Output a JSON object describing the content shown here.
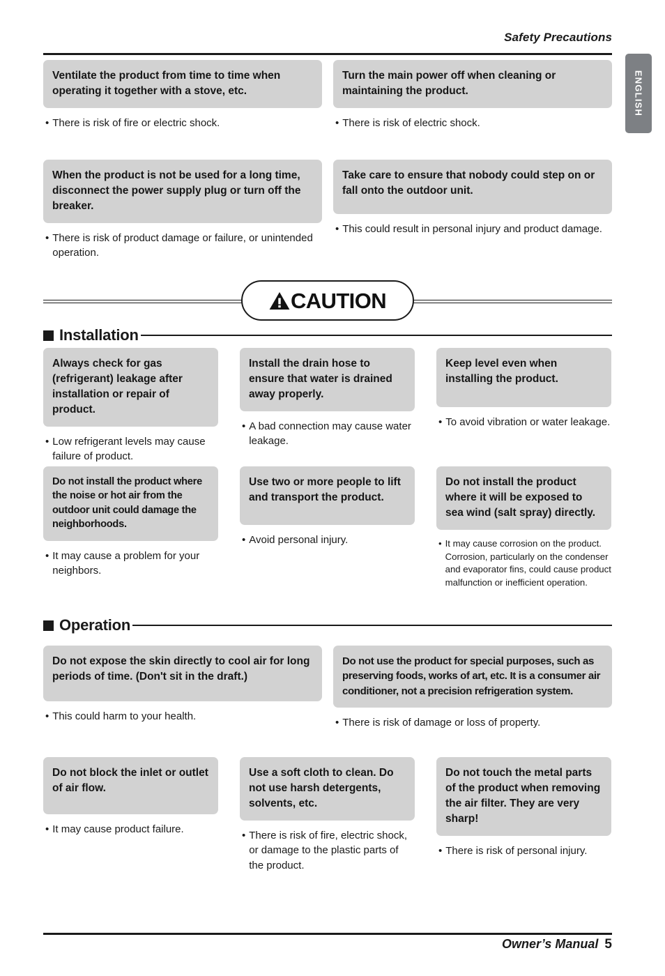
{
  "header": {
    "title": "Safety Precautions",
    "language_tab": "ENGLISH"
  },
  "caution": {
    "label": "CAUTION",
    "icon": "warning-triangle-icon"
  },
  "sections": [
    {
      "id": "warning-continued",
      "rows": [
        {
          "columns": 2,
          "cells": [
            {
              "heading": "Ventilate the product from time to time when operating it together with a stove, etc.",
              "note": "There is risk of fire or electric shock."
            },
            {
              "heading": "Turn the main power off when cleaning or maintaining the product.",
              "note": "There is risk of electric shock."
            }
          ]
        },
        {
          "columns": 2,
          "cells": [
            {
              "heading": "When the product is not be used for a long time, disconnect the power supply plug or turn off the breaker.",
              "note": "There is risk of product damage or failure, or unintended operation."
            },
            {
              "heading": "Take care to ensure that nobody could step on or fall onto the outdoor unit.",
              "note": "This could result in personal injury and product damage."
            }
          ]
        }
      ]
    },
    {
      "id": "installation",
      "title": "Installation",
      "marker": "black-square-icon",
      "rows": [
        {
          "columns": 3,
          "cells": [
            {
              "heading": "Always check for gas (refrigerant) leakage after installation or repair of product.",
              "note": "Low refrigerant levels may cause failure of product."
            },
            {
              "heading": "Install the drain hose to ensure that water is drained away properly.",
              "note": "A bad connection may cause water leakage."
            },
            {
              "heading": "Keep level even when installing the product.",
              "note": "To avoid vibration or water leakage."
            }
          ]
        },
        {
          "columns": 3,
          "cells": [
            {
              "heading": "Do not install the product where the noise or hot air from the outdoor unit could damage the neighborhoods.",
              "note": "It may cause a problem for your neighbors."
            },
            {
              "heading": "Use two or more people to lift and transport the product.",
              "note": "Avoid personal injury."
            },
            {
              "heading": "Do not install the product where it will be exposed to sea wind (salt spray) directly.",
              "note": "It may cause corrosion on the product. Corrosion, particularly on the condenser and evaporator fins, could cause product malfunction or inefficient operation."
            }
          ]
        }
      ]
    },
    {
      "id": "operation",
      "title": "Operation",
      "marker": "black-square-icon",
      "rows": [
        {
          "columns": 2,
          "cells": [
            {
              "heading": "Do not expose the skin directly to cool air for long periods of time. (Don't sit in the draft.)",
              "note": "This could harm to your health."
            },
            {
              "heading": "Do not use the product for special purposes, such as preserving foods, works of art, etc. It is a consumer air conditioner, not a precision refrigeration system.",
              "note": "There is risk of damage or loss of property."
            }
          ]
        },
        {
          "columns": 3,
          "cells": [
            {
              "heading": "Do not block the inlet or outlet of air flow.",
              "note": "It may cause product failure."
            },
            {
              "heading": "Use a soft cloth to clean. Do not use harsh detergents, solvents, etc.",
              "note": "There is risk of fire, electric shock, or damage to the plastic parts of the product."
            },
            {
              "heading": "Do not touch the metal parts of the product when removing the air filter. They are very sharp!",
              "note": "There is risk of personal injury."
            }
          ]
        }
      ]
    }
  ],
  "footer": {
    "manual_label": "Owner’s Manual",
    "page_number": "5"
  },
  "colors": {
    "tile_background": "#d2d2d2",
    "rule": "#1a1a1a",
    "lang_tab": "#7d8084",
    "text": "#1a1a1a"
  }
}
